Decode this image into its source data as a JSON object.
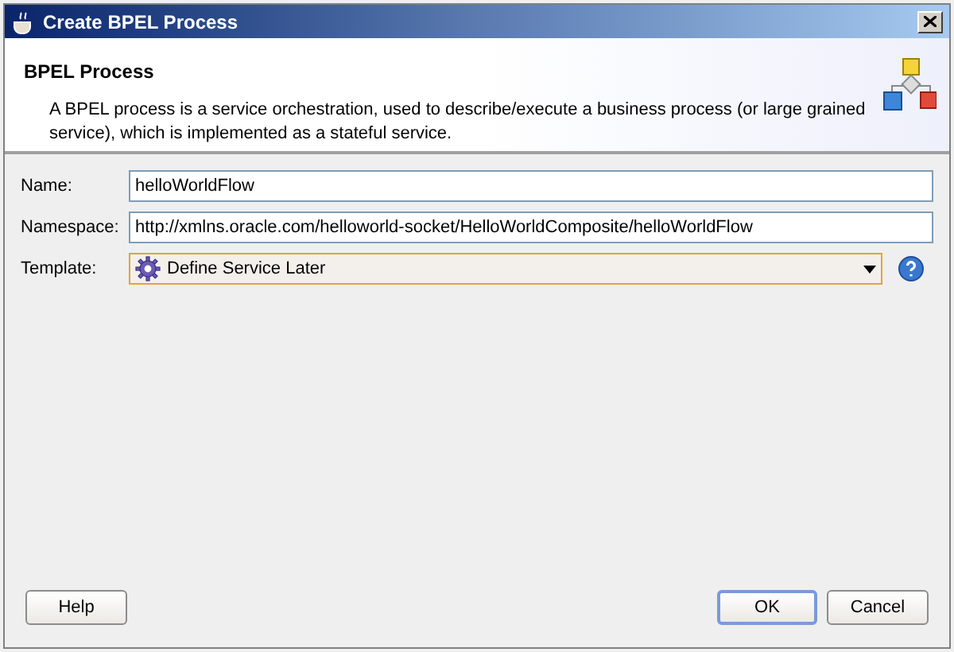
{
  "window": {
    "title": "Create BPEL Process"
  },
  "header": {
    "title": "BPEL Process",
    "description": "A BPEL process is a service orchestration, used to describe/execute a business process (or large grained service), which is implemented as a stateful service."
  },
  "fields": [
    {
      "kind": "text",
      "label": "Name:",
      "value": "helloWorldFlow"
    },
    {
      "kind": "text",
      "label": "Namespace:",
      "value": "http://xmlns.oracle.com/helloworld-socket/HelloWorldComposite/helloWorldFlow"
    },
    {
      "kind": "dropdown",
      "label": "Template:",
      "value": "Define Service Later"
    }
  ],
  "buttons": [
    {
      "label": "Help",
      "default": false
    },
    {
      "label": "OK",
      "default": true
    },
    {
      "label": "Cancel",
      "default": false
    }
  ]
}
